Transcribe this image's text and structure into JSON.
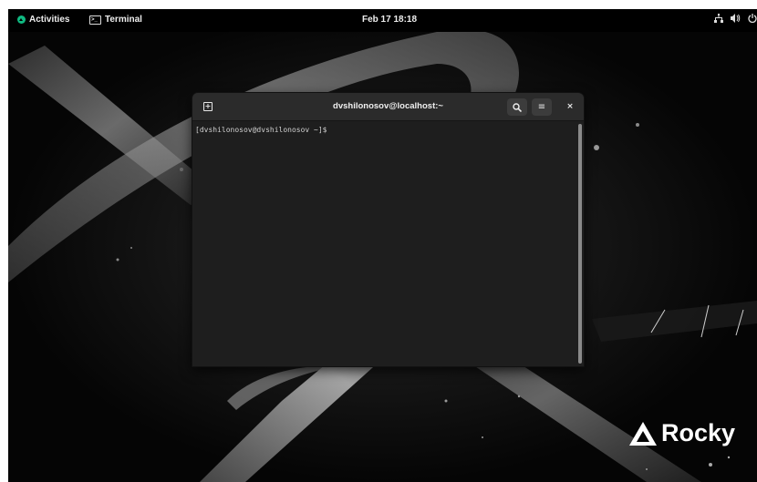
{
  "topbar": {
    "activities_label": "Activities",
    "app_label": "Terminal",
    "clock": "Feb 17  18:18",
    "tray_icons": [
      "network-icon",
      "volume-icon",
      "power-icon"
    ]
  },
  "terminal": {
    "title": "dvshilonosov@localhost:~",
    "prompt": "[dvshilonosov@dvshilonosov ~]$ ",
    "buttons": {
      "new_tab": "+",
      "search": "🔍",
      "menu": "≡",
      "close": "×"
    }
  },
  "wallpaper": {
    "logo_text": "Rocky"
  },
  "colors": {
    "accent": "#10b981",
    "topbar_bg": "#000000",
    "window_bg": "#1f1f1f",
    "headerbar_bg": "#2b2b2b"
  }
}
